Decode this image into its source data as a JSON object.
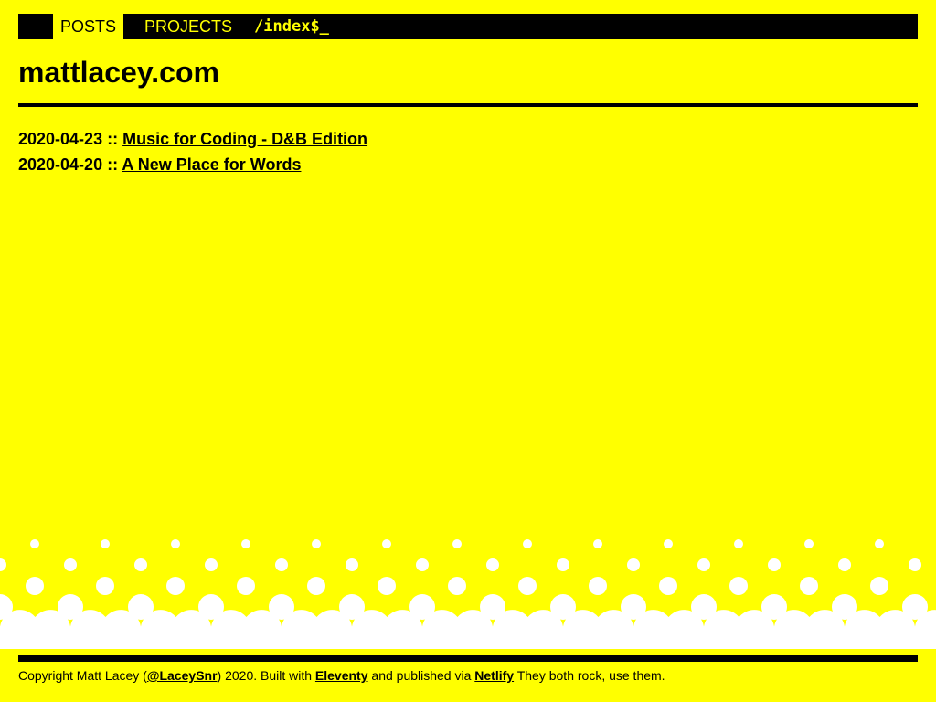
{
  "nav": {
    "posts_label": "POSTS",
    "projects_label": "PROJECTS",
    "path_text": "/index$_"
  },
  "site": {
    "title": "mattlacey.com"
  },
  "posts": [
    {
      "date": "2020-04-23",
      "separator": " :: ",
      "title": "Music for Coding - D&B Edition"
    },
    {
      "date": "2020-04-20",
      "separator": " :: ",
      "title": "A New Place for Words"
    }
  ],
  "footer": {
    "prefix": "Copyright Matt Lacey (",
    "twitter_link": "@LaceySnr",
    "mid1": ") 2020. Built with ",
    "eleventy_link": "Eleventy",
    "mid2": " and published via ",
    "netlify_link": "Netlify",
    "suffix": " They both rock, use them."
  },
  "colors": {
    "background": "#ffff00",
    "foreground": "#000000",
    "wave": "#ffffff"
  }
}
